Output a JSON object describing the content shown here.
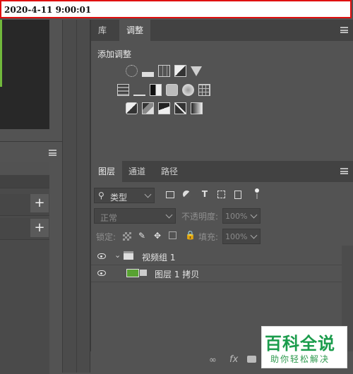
{
  "timestamp": "2020-4-11 9:00:01",
  "adjustments_panel": {
    "tabs": [
      {
        "label": "库"
      },
      {
        "label": "调整"
      }
    ],
    "title": "添加调整",
    "row1_icons": [
      "brightness-contrast-icon",
      "levels-icon",
      "curves-icon",
      "exposure-icon",
      "vibrance-icon"
    ],
    "row2_icons": [
      "hue-saturation-icon",
      "color-balance-icon",
      "black-white-icon",
      "photo-filter-icon",
      "channel-mixer-icon",
      "color-lookup-icon"
    ],
    "row3_icons": [
      "invert-icon",
      "posterize-icon",
      "threshold-icon",
      "selective-color-icon",
      "gradient-map-icon"
    ]
  },
  "layers_panel": {
    "tabs": [
      {
        "label": "图层"
      },
      {
        "label": "通道"
      },
      {
        "label": "路径"
      }
    ],
    "filter_kind": "类型",
    "blend_mode": "正常",
    "opacity_label": "不透明度:",
    "opacity_value": "100%",
    "lock_label": "锁定:",
    "fill_label": "填充:",
    "fill_value": "100%",
    "layers": [
      {
        "name": "视频组 1",
        "type": "group"
      },
      {
        "name": "图层 1 拷贝",
        "type": "video-layer"
      }
    ],
    "bottom_icons": [
      "link-icon",
      "fx-icon",
      "mask-icon"
    ]
  },
  "left_panel": {
    "plus_buttons": [
      "+",
      "+"
    ]
  },
  "watermark": {
    "title": "百科全说",
    "subtitle": "助你轻松解决"
  }
}
